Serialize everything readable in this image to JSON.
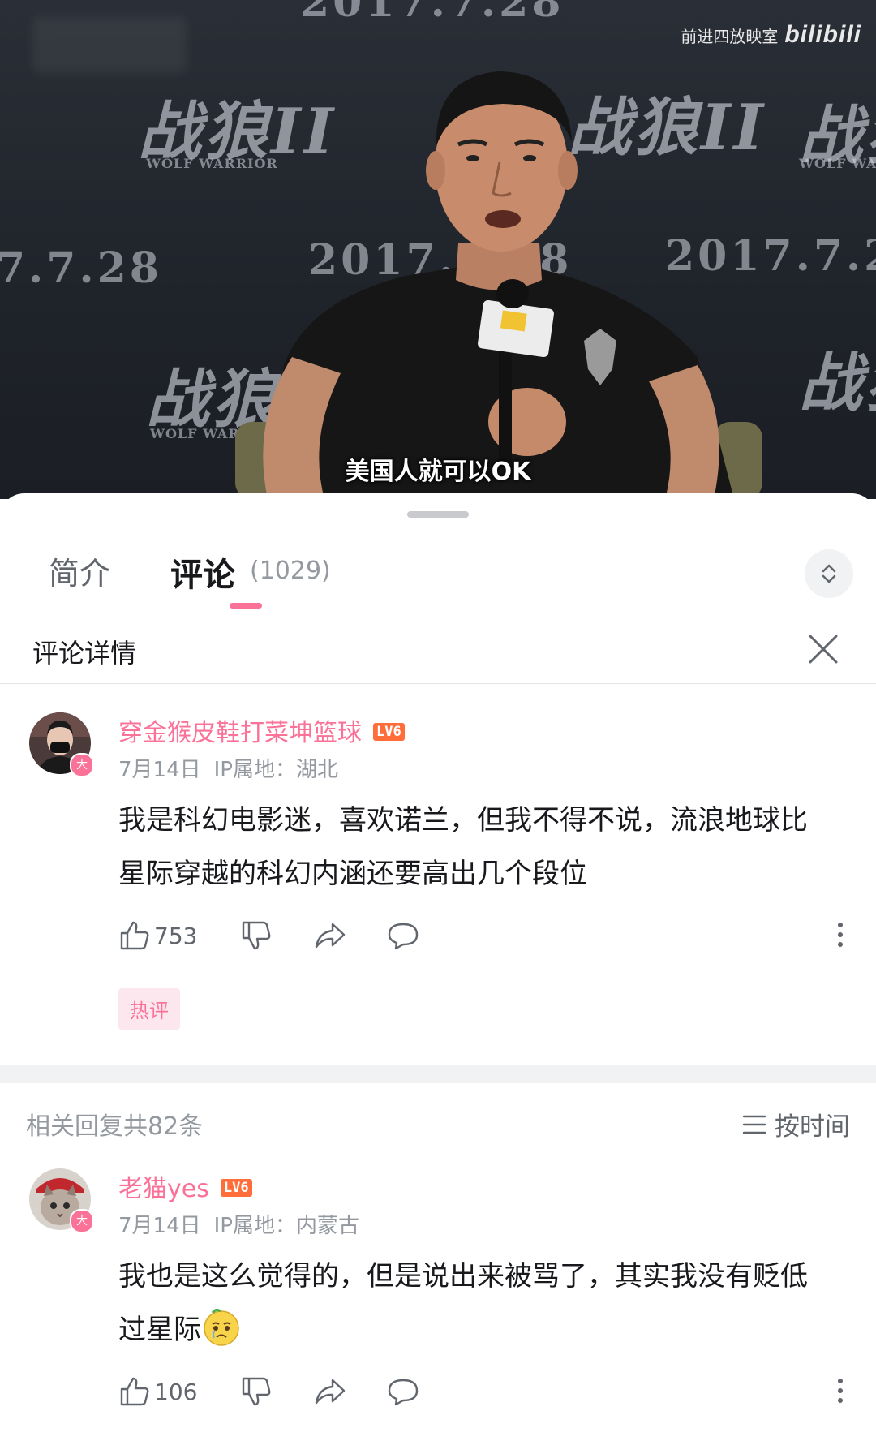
{
  "video": {
    "watermark_channel": "前进四放映室",
    "watermark_brand": "bilibili",
    "subtitle": "美国人就可以OK",
    "backdrop_logo": "战狼II",
    "backdrop_date_1": "2017.7.28",
    "backdrop_date_2": "2017.7.28",
    "backdrop_date_3": "7.7.28",
    "backdrop_small": "WOLF WARRIOR"
  },
  "tabs": {
    "intro_label": "简介",
    "comments_label": "评论",
    "comments_count": "(1029)",
    "accent_color": "#fb7299"
  },
  "detail": {
    "title": "评论详情"
  },
  "main_comment": {
    "username": "穿金猴皮鞋打菜坤篮球",
    "level": "LV6",
    "date": "7月14日",
    "ip": "IP属地：湖北",
    "text": "我是科幻电影迷，喜欢诺兰，但我不得不说，流浪地球比星际穿越的科幻内涵还要高出几个段位",
    "likes": "753",
    "tag": "热评",
    "avatar_badge": "大"
  },
  "replies": {
    "count_label": "相关回复共82条",
    "sort_label": "按时间"
  },
  "reply_1": {
    "username": "老猫yes",
    "level": "LV6",
    "date": "7月14日",
    "ip": "IP属地：内蒙古",
    "text": "我也是这么觉得的，但是说出来被骂了，其实我没有贬低过星际",
    "emoji": "crying-face-emoji",
    "likes": "106",
    "avatar_badge": "大"
  },
  "icons": {
    "like": "thumb-up-icon",
    "dislike": "thumb-down-icon",
    "share": "share-icon",
    "reply": "comment-icon",
    "more": "more-vertical-icon",
    "close": "close-icon",
    "expand": "expand-icon",
    "sort": "sort-lines-icon"
  }
}
